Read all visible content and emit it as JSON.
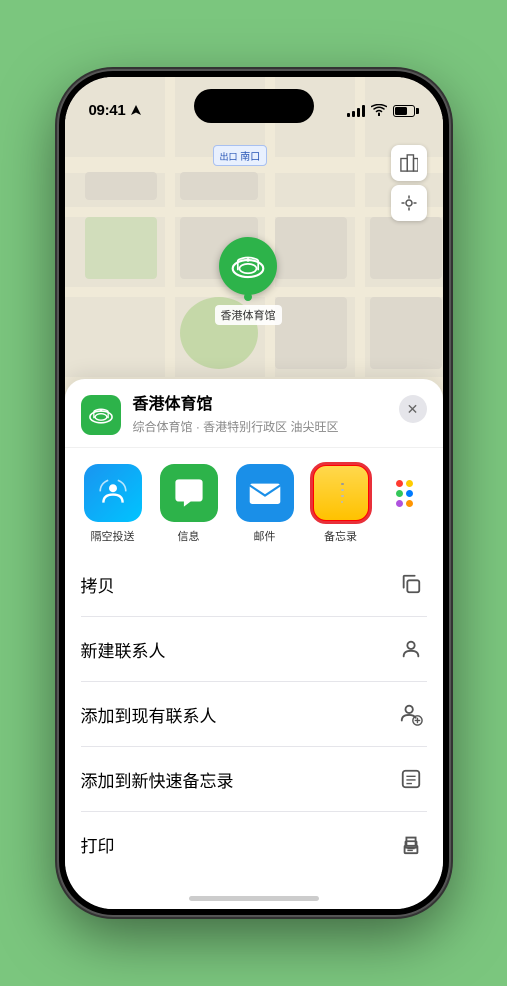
{
  "status_bar": {
    "time": "09:41",
    "location_arrow": "▶"
  },
  "map": {
    "label": "南口",
    "label_prefix": "出口"
  },
  "controls": {
    "map_btn": "🗺",
    "location_btn": "◎"
  },
  "stadium": {
    "pin_icon": "🏟",
    "label": "香港体育馆"
  },
  "location_card": {
    "icon": "🏟",
    "name": "香港体育馆",
    "description": "综合体育馆 · 香港特别行政区 油尖旺区",
    "close": "✕"
  },
  "apps": [
    {
      "id": "airdrop",
      "label": "隔空投送"
    },
    {
      "id": "messages",
      "label": "信息"
    },
    {
      "id": "mail",
      "label": "邮件"
    },
    {
      "id": "notes",
      "label": "备忘录"
    }
  ],
  "actions": [
    {
      "label": "拷贝",
      "icon": "copy"
    },
    {
      "label": "新建联系人",
      "icon": "person"
    },
    {
      "label": "添加到现有联系人",
      "icon": "person-add"
    },
    {
      "label": "添加到新快速备忘录",
      "icon": "note"
    },
    {
      "label": "打印",
      "icon": "print"
    }
  ]
}
